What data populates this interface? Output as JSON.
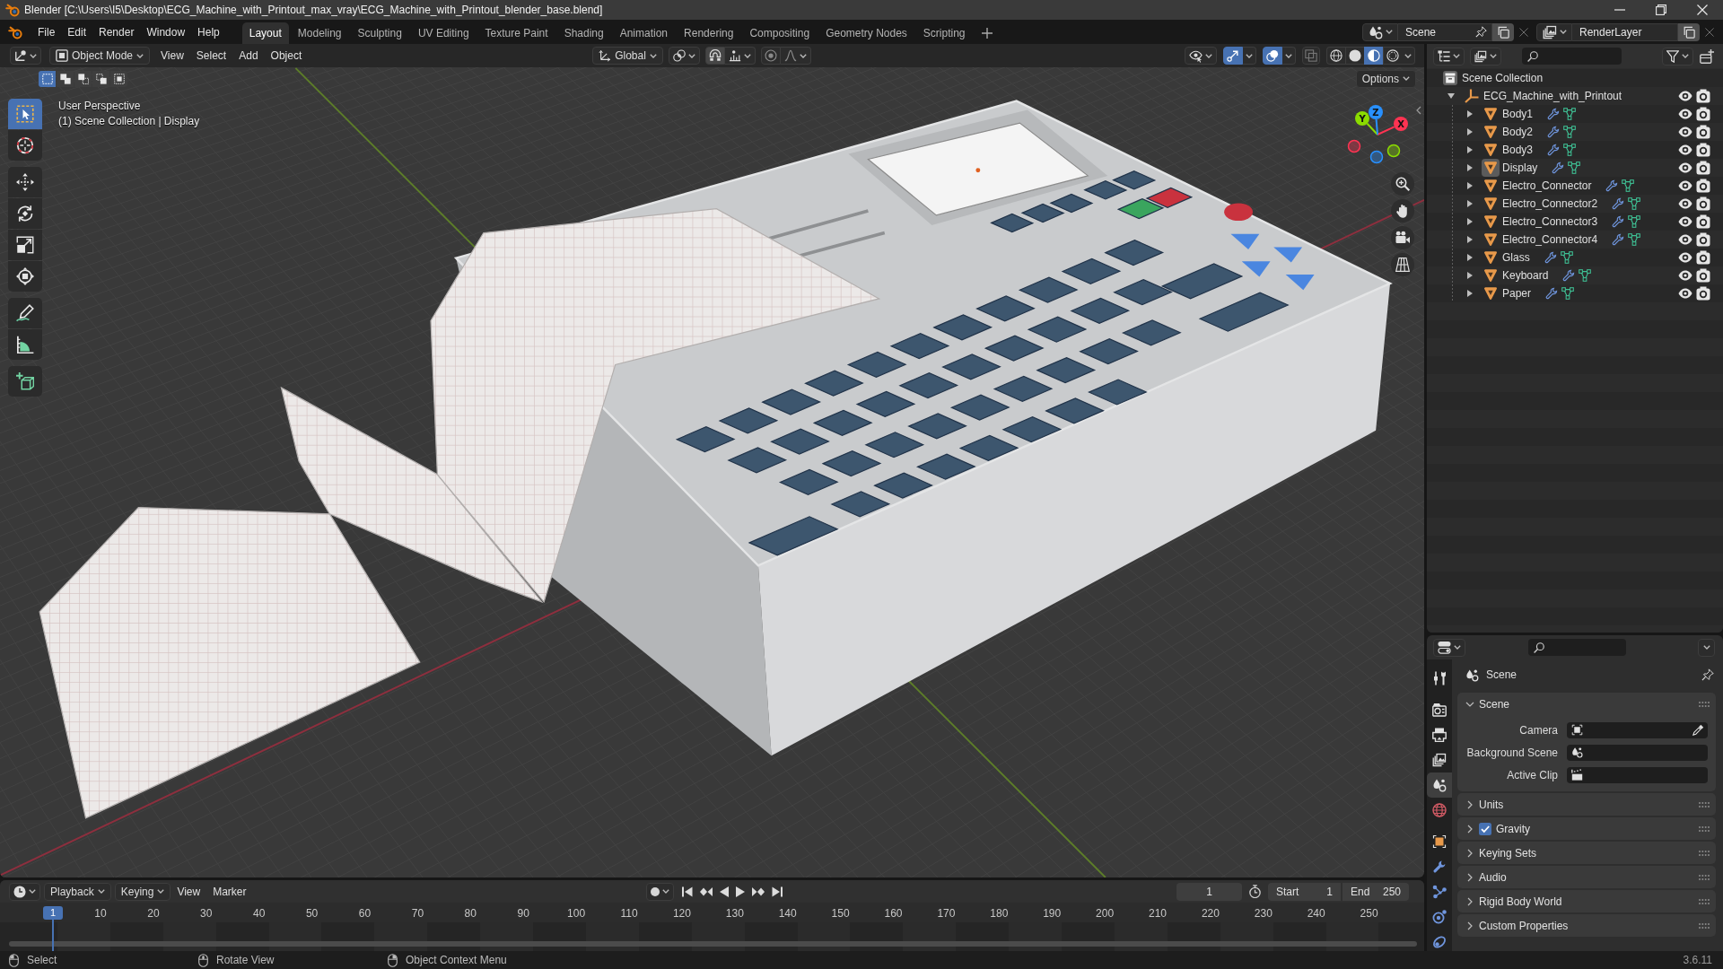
{
  "window": {
    "title": "Blender [C:\\Users\\I5\\Desktop\\ECG_Machine_with_Printout_max_vray\\ECG_Machine_with_Printout_blender_base.blend]"
  },
  "menu": [
    "File",
    "Edit",
    "Render",
    "Window",
    "Help"
  ],
  "workspaces": [
    {
      "label": "Layout",
      "selected": true
    },
    {
      "label": "Modeling",
      "selected": false
    },
    {
      "label": "Sculpting",
      "selected": false
    },
    {
      "label": "UV Editing",
      "selected": false
    },
    {
      "label": "Texture Paint",
      "selected": false
    },
    {
      "label": "Shading",
      "selected": false
    },
    {
      "label": "Animation",
      "selected": false
    },
    {
      "label": "Rendering",
      "selected": false
    },
    {
      "label": "Compositing",
      "selected": false
    },
    {
      "label": "Geometry Nodes",
      "selected": false
    },
    {
      "label": "Scripting",
      "selected": false
    }
  ],
  "scene_selector": {
    "value": "Scene"
  },
  "view_layer_selector": {
    "value": "RenderLayer"
  },
  "viewport": {
    "mode": "Object Mode",
    "menus": [
      "View",
      "Select",
      "Add",
      "Object"
    ],
    "orientation": "Global",
    "toggles": [
      {
        "kind": "gizmos",
        "on": true
      },
      {
        "kind": "overlays",
        "on": true
      },
      {
        "kind": "xray",
        "on": false
      }
    ],
    "shading": [
      {
        "kind": "wireframe",
        "selected": false
      },
      {
        "kind": "solid",
        "selected": false
      },
      {
        "kind": "material",
        "selected": true
      },
      {
        "kind": "rendered",
        "selected": false
      }
    ],
    "select_modes": [
      {
        "kind": "set",
        "selected": true
      },
      {
        "kind": "extend",
        "selected": false
      },
      {
        "kind": "subtract",
        "selected": false
      },
      {
        "kind": "invert",
        "selected": false
      },
      {
        "kind": "intersect",
        "selected": false
      }
    ],
    "options_label": "Options",
    "view_name": "User Perspective",
    "context": "(1) Scene Collection | Display",
    "toolbar": [
      [
        {
          "kind": "select_box",
          "selected": true
        },
        {
          "kind": "cursor",
          "selected": false
        }
      ],
      [
        {
          "kind": "move",
          "selected": false
        },
        {
          "kind": "rotate",
          "selected": false
        },
        {
          "kind": "scale",
          "selected": false
        },
        {
          "kind": "transform",
          "selected": false
        }
      ],
      [
        {
          "kind": "annotate",
          "selected": false
        },
        {
          "kind": "measure",
          "selected": false
        }
      ],
      [
        {
          "kind": "add_cube",
          "selected": false
        }
      ]
    ],
    "navigation_gizmo": [
      {
        "label": "X",
        "color": "#ff3352"
      },
      {
        "label": "Y",
        "color": "#8bdc00"
      },
      {
        "label": "Z",
        "color": "#2890ff"
      }
    ]
  },
  "outliner": {
    "root": "Scene Collection",
    "items": [
      {
        "name": "ECG_Machine_with_Printout",
        "kind": "empty",
        "expanded": true,
        "active": false,
        "visible": true,
        "renderable": true,
        "children": [
          {
            "name": "Body1",
            "kind": "mesh",
            "expanded": false,
            "active": false,
            "visible": true,
            "renderable": true
          },
          {
            "name": "Body2",
            "kind": "mesh",
            "expanded": false,
            "active": false,
            "visible": true,
            "renderable": true
          },
          {
            "name": "Body3",
            "kind": "mesh",
            "expanded": false,
            "active": false,
            "visible": true,
            "renderable": true
          },
          {
            "name": "Display",
            "kind": "mesh",
            "expanded": false,
            "active": true,
            "visible": true,
            "renderable": true
          },
          {
            "name": "Electro_Connector",
            "kind": "mesh",
            "expanded": false,
            "active": false,
            "visible": true,
            "renderable": true
          },
          {
            "name": "Electro_Connector2",
            "kind": "mesh",
            "expanded": false,
            "active": false,
            "visible": true,
            "renderable": true
          },
          {
            "name": "Electro_Connector3",
            "kind": "mesh",
            "expanded": false,
            "active": false,
            "visible": true,
            "renderable": true
          },
          {
            "name": "Electro_Connector4",
            "kind": "mesh",
            "expanded": false,
            "active": false,
            "visible": true,
            "renderable": true
          },
          {
            "name": "Glass",
            "kind": "mesh",
            "expanded": false,
            "active": false,
            "visible": true,
            "renderable": true
          },
          {
            "name": "Keyboard",
            "kind": "mesh",
            "expanded": false,
            "active": false,
            "visible": true,
            "renderable": true
          },
          {
            "name": "Paper",
            "kind": "mesh",
            "expanded": false,
            "active": false,
            "visible": true,
            "renderable": true
          }
        ]
      }
    ]
  },
  "properties": {
    "tabs": [
      [
        {
          "kind": "tool",
          "selected": false
        }
      ],
      [
        {
          "kind": "render",
          "selected": false
        },
        {
          "kind": "output",
          "selected": false
        },
        {
          "kind": "view_layer",
          "selected": false
        },
        {
          "kind": "scene",
          "selected": true
        },
        {
          "kind": "world",
          "selected": false
        }
      ],
      [
        {
          "kind": "object",
          "selected": false
        },
        {
          "kind": "modifiers",
          "selected": false
        },
        {
          "kind": "particles",
          "selected": false
        },
        {
          "kind": "physics",
          "selected": false
        },
        {
          "kind": "constraints",
          "selected": false
        }
      ]
    ],
    "context": "Scene",
    "panels": [
      {
        "title": "Scene",
        "kind": "plain",
        "expanded": true,
        "fields": [
          {
            "label": "Camera",
            "kind": "camera"
          },
          {
            "label": "Background Scene",
            "kind": "scene"
          },
          {
            "label": "Active Clip",
            "kind": "clip"
          }
        ]
      },
      {
        "title": "Units",
        "kind": "plain",
        "expanded": false
      },
      {
        "title": "Gravity",
        "kind": "toggle",
        "checked": true,
        "expanded": false
      },
      {
        "title": "Keying Sets",
        "kind": "plain",
        "expanded": false
      },
      {
        "title": "Audio",
        "kind": "plain",
        "expanded": false
      },
      {
        "title": "Rigid Body World",
        "kind": "plain",
        "expanded": false
      },
      {
        "title": "Custom Properties",
        "kind": "plain",
        "expanded": false
      }
    ]
  },
  "timeline": {
    "menus": [
      {
        "label": "Playback",
        "kind": "dropdown"
      },
      {
        "label": "Keying",
        "kind": "dropdown"
      },
      {
        "label": "View",
        "kind": "menu"
      },
      {
        "label": "Marker",
        "kind": "menu"
      }
    ],
    "auto_keying": {
      "on": false
    },
    "current_frame": "1",
    "start": {
      "label": "Start",
      "value": "1"
    },
    "end": {
      "label": "End",
      "value": "250"
    },
    "playhead": "1",
    "ruler": [
      "10",
      "20",
      "30",
      "40",
      "50",
      "60",
      "70",
      "80",
      "90",
      "100",
      "110",
      "120",
      "130",
      "140",
      "150",
      "160",
      "170",
      "180",
      "190",
      "200",
      "210",
      "220",
      "230",
      "240",
      "250"
    ]
  },
  "status_bar": {
    "hints": [
      {
        "kind": "left",
        "text": "Select"
      },
      {
        "kind": "middle",
        "text": "Rotate View"
      },
      {
        "kind": "right",
        "text": "Object Context Menu"
      }
    ],
    "version": "3.6.11"
  }
}
